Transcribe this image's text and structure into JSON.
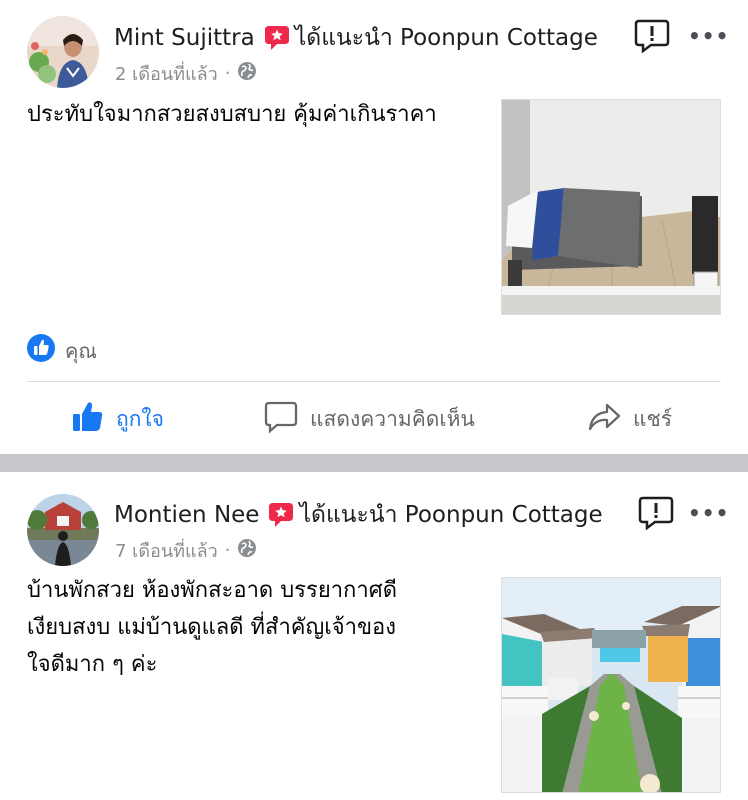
{
  "posts": [
    {
      "author": "Mint Sujittra",
      "action_text": "ได้แนะนำ Poonpun Cottage",
      "time": "2 เดือนที่แล้ว",
      "meta_separator": "·",
      "more_label": "•••",
      "body": [
        "ประทับใจมากสวยสงบสบาย คุ้มค่าเกินราคา"
      ],
      "likes_label": "คุณ",
      "actions": {
        "like": "ถูกใจ",
        "comment": "แสดงความคิดเห็น",
        "share": "แชร์"
      }
    },
    {
      "author": "Montien Nee",
      "action_text": "ได้แนะนำ Poonpun Cottage",
      "time": "7 เดือนที่แล้ว",
      "meta_separator": "·",
      "more_label": "•••",
      "body": [
        "บ้านพักสวย ห้องพักสะอาด บรรยากาศดี",
        "เงียบสงบ แม่บ้านดูแลดี ที่สำคัญเจ้าของ",
        "ใจดีมาก ๆ ค่ะ"
      ]
    }
  ],
  "colors": {
    "like_blue": "#1877f2",
    "recommend_red": "#f02849",
    "meta_gray": "#8a8d91",
    "separator": "#c6c8cd"
  },
  "icons": {
    "recommend_badge": "recommend-badge-icon",
    "globe": "globe-icon",
    "report": "report-icon",
    "thumbs_up": "thumbs-up-icon",
    "comment": "comment-icon",
    "share": "share-icon"
  }
}
